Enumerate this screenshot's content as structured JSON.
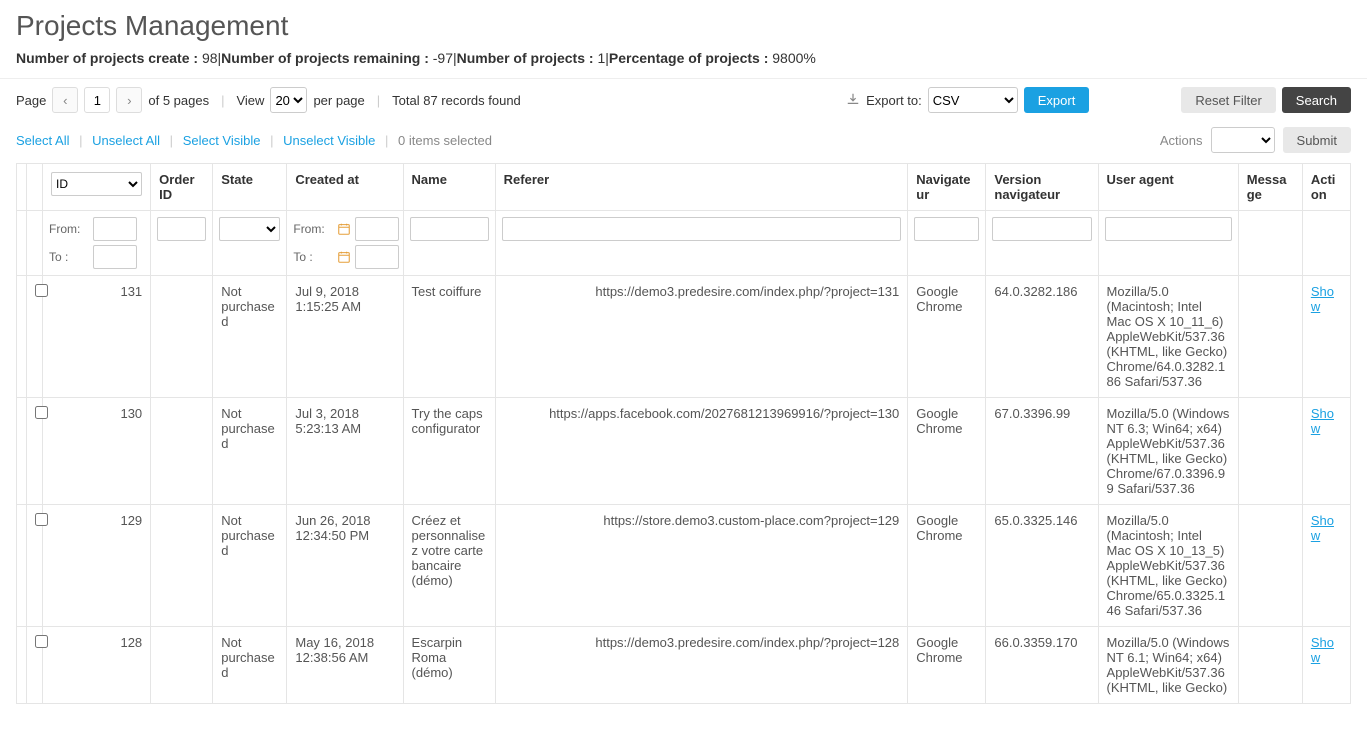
{
  "page_title": "Projects Management",
  "stats": {
    "label_create": "Number of projects create :",
    "create_val": "98",
    "label_remaining": "Number of projects remaining :",
    "remaining_val": "-97",
    "label_total": "Number of projects :",
    "total_val": "1",
    "label_pct": "Percentage of projects :",
    "pct_val": "9800%"
  },
  "pager": {
    "page_label": "Page",
    "page_value": "1",
    "of_label": "of 5 pages",
    "view_label": "View",
    "per_page_value": "20",
    "per_page_label": "per page",
    "total_label": "Total 87 records found"
  },
  "export": {
    "label": "Export to:",
    "format": "CSV",
    "button": "Export"
  },
  "buttons": {
    "reset_filter": "Reset Filter",
    "search": "Search",
    "submit": "Submit"
  },
  "selection": {
    "select_all": "Select All",
    "unselect_all": "Unselect All",
    "select_visible": "Select Visible",
    "unselect_visible": "Unselect Visible",
    "items_selected": "0 items selected",
    "actions_label": "Actions"
  },
  "headers": {
    "id": "ID",
    "order": "Order ID",
    "state": "State",
    "created": "Created at",
    "name": "Name",
    "referer": "Referer",
    "navigateur": "Navigateur",
    "version": "Version navigateur",
    "ua": "User agent",
    "message": "Message",
    "action": "Action"
  },
  "filters": {
    "from_label": "From:",
    "to_label": "To :"
  },
  "rows": [
    {
      "id": "131",
      "state": "Not purchased",
      "created": "Jul 9, 2018 1:15:25 AM",
      "name": "Test coiffure",
      "referer": "https://demo3.predesire.com/index.php/?project=131",
      "nav": "Google Chrome",
      "ver": "64.0.3282.186",
      "ua": "Mozilla/5.0 (Macintosh; Intel Mac OS X 10_11_6) AppleWebKit/537.36 (KHTML, like Gecko) Chrome/64.0.3282.186 Safari/537.36",
      "action": "Show"
    },
    {
      "id": "130",
      "state": "Not purchased",
      "created": "Jul 3, 2018 5:23:13 AM",
      "name": "Try the caps configurator",
      "referer": "https://apps.facebook.com/2027681213969916/?project=130",
      "nav": "Google Chrome",
      "ver": "67.0.3396.99",
      "ua": "Mozilla/5.0 (Windows NT 6.3; Win64; x64) AppleWebKit/537.36 (KHTML, like Gecko) Chrome/67.0.3396.99 Safari/537.36",
      "action": "Show"
    },
    {
      "id": "129",
      "state": "Not purchased",
      "created": "Jun 26, 2018 12:34:50 PM",
      "name": "Créez et personnalisez votre carte bancaire (démo)",
      "referer": "https://store.demo3.custom-place.com?project=129",
      "nav": "Google Chrome",
      "ver": "65.0.3325.146",
      "ua": "Mozilla/5.0 (Macintosh; Intel Mac OS X 10_13_5) AppleWebKit/537.36 (KHTML, like Gecko) Chrome/65.0.3325.146 Safari/537.36",
      "action": "Show"
    },
    {
      "id": "128",
      "state": "Not purchased",
      "created": "May 16, 2018 12:38:56 AM",
      "name": "Escarpin Roma (démo)",
      "referer": "https://demo3.predesire.com/index.php/?project=128",
      "nav": "Google Chrome",
      "ver": "66.0.3359.170",
      "ua": "Mozilla/5.0 (Windows NT 6.1; Win64; x64) AppleWebKit/537.36 (KHTML, like Gecko)",
      "action": "Show"
    }
  ]
}
